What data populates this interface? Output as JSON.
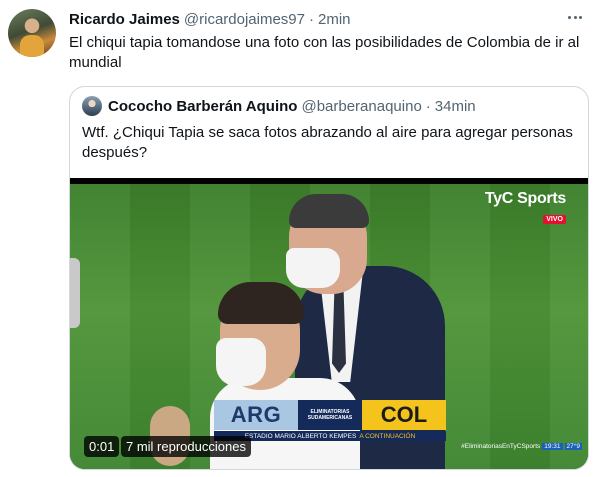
{
  "tweet": {
    "author_name": "Ricardo Jaimes",
    "author_handle": "@ricardojaimes97",
    "separator": "·",
    "time": "2min",
    "text": "El chiqui tapia tomandose una foto con las posibilidades de Colombia de ir al mundial",
    "more_icon": "more-horizontal-icon"
  },
  "quote": {
    "author_name": "Cococho Barberán Aquino",
    "author_handle": "@barberanaquino",
    "separator": "·",
    "time": "34min",
    "text": "Wtf. ¿Chiqui Tapia se saca fotos abrazando al aire para agregar personas después?"
  },
  "video": {
    "broadcaster": "TyC Sports",
    "live_badge": "VIVO",
    "team_home": "ARG",
    "competition_line1": "ELIMINATORIAS",
    "competition_line2": "SUDAMERICANAS",
    "team_away": "COL",
    "venue": "ESTADIO MARIO ALBERTO KEMPES",
    "venue_status": "A CONTINUACIÓN",
    "hashtag": "#EliminatoriasEnTyCSports",
    "clock": "19:31",
    "temperature": "27°9",
    "elapsed": "0:01",
    "views": "7 mil reproducciones"
  }
}
